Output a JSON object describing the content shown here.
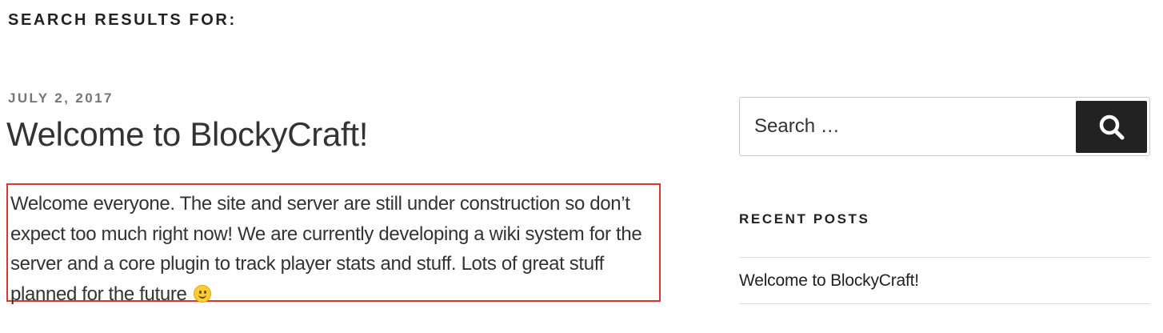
{
  "page_header": {
    "title": "SEARCH RESULTS FOR:"
  },
  "post": {
    "date": "JULY 2, 2017",
    "title": "Welcome to BlockyCraft!",
    "excerpt": "Welcome everyone. The site and server are still under construction so don’t expect too much right now! We are currently developing a wiki system for the server and a core plugin to track player stats and stuff. Lots of great stuff planned for the future",
    "excerpt_emoji": "smiley-face-icon"
  },
  "sidebar": {
    "search": {
      "placeholder": "Search …",
      "button_icon": "search-icon"
    },
    "recent_posts": {
      "title": "RECENT POSTS",
      "items": [
        {
          "label": "Welcome to BlockyCraft!"
        }
      ]
    }
  },
  "colors": {
    "highlight_border": "#d9392b",
    "button_bg": "#222222",
    "date_gray": "#767676"
  }
}
